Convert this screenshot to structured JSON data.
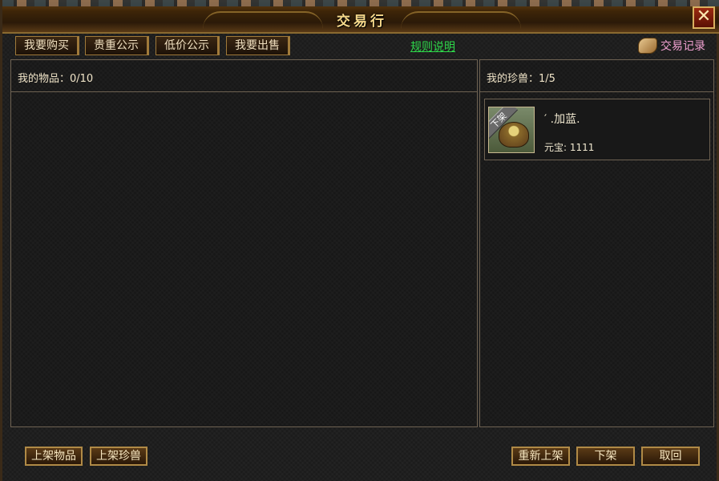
{
  "window": {
    "title": "交易行",
    "close_glyph": "✕"
  },
  "tabs": [
    {
      "label": "我要购买"
    },
    {
      "label": "贵重公示"
    },
    {
      "label": "低价公示"
    },
    {
      "label": "我要出售"
    }
  ],
  "rules_link": "规则说明",
  "record_button": {
    "label": "交易记录",
    "icon": "scroll-icon"
  },
  "left_panel": {
    "title": "我的物品：0/10"
  },
  "right_panel": {
    "title": "我的珍兽：1/5",
    "pets": [
      {
        "ribbon": "下架",
        "name": "′ .加蓝.",
        "price": "元宝: 1111"
      }
    ]
  },
  "buttons": {
    "list_item": "上架物品",
    "list_pet": "上架珍兽",
    "relist": "重新上架",
    "delist": "下架",
    "retrieve": "取回"
  },
  "colors": {
    "accent_gold": "#f6d88a",
    "link_green": "#2ed84a",
    "record_pink": "#f0a0d0"
  }
}
